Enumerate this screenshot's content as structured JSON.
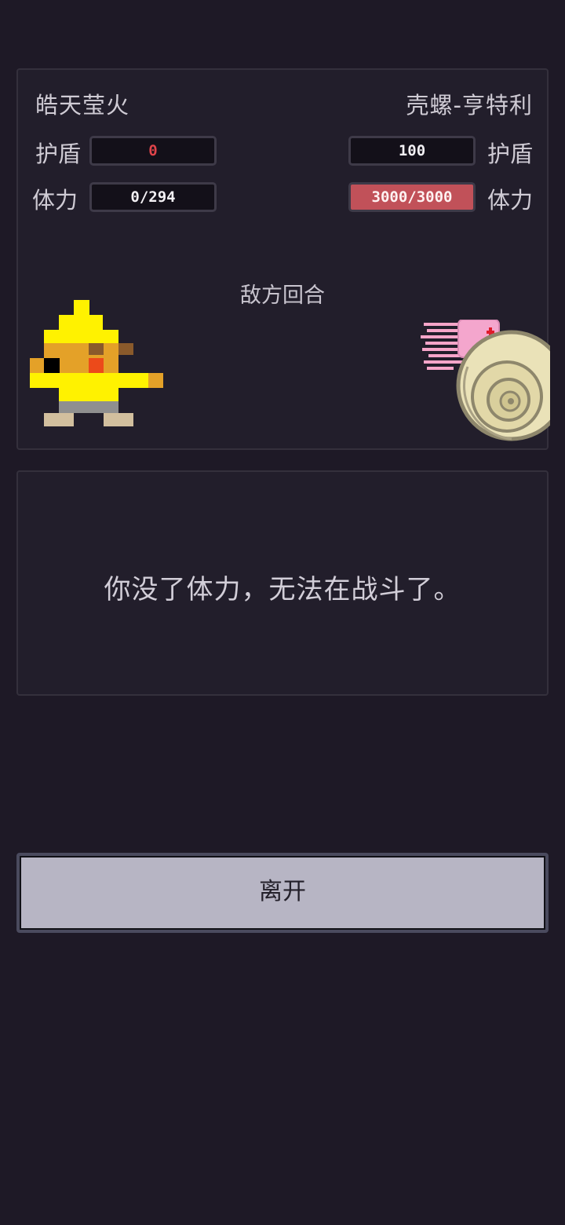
{
  "player": {
    "name": "皓天莹火",
    "shield_label": "护盾",
    "shield_value": "0",
    "hp_label": "体力",
    "hp_value": "0/294"
  },
  "enemy": {
    "name": "壳螺-亨特利",
    "shield_label": "护盾",
    "shield_value": "100",
    "hp_label": "体力",
    "hp_value": "3000/3000"
  },
  "turn_text": "敌方回合",
  "message": "你没了体力，无法在战斗了。",
  "leave_button_label": "离开",
  "colors": {
    "background": "#1e1926",
    "panel": "#221e2b",
    "shield_zero": "#e0444a",
    "enemy_hp_bar": "#c15159",
    "button": "#b7b5c4"
  },
  "icons": {
    "player_sprite": "pixel-yellow-hero-sprite",
    "enemy_sprite": "pixel-nautilus-sprite"
  }
}
